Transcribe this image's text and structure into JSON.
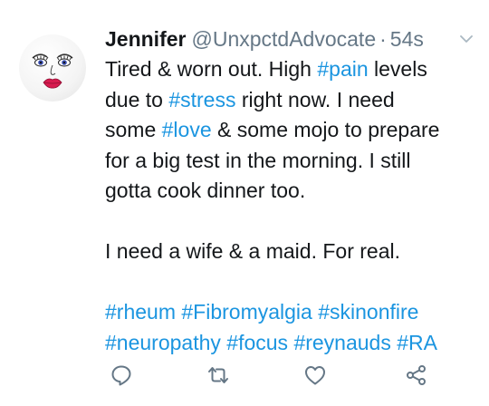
{
  "tweet": {
    "display_name": "Jennifer",
    "handle": "@UnxpctdAdvocate",
    "separator": "·",
    "timestamp": "54s",
    "lines": [
      [
        {
          "t": "Tired & worn out. High ",
          "tag": false
        },
        {
          "t": "#pain",
          "tag": true
        },
        {
          "t": " levels",
          "tag": false
        }
      ],
      [
        {
          "t": "due to ",
          "tag": false
        },
        {
          "t": "#stress",
          "tag": true
        },
        {
          "t": " right now. I need",
          "tag": false
        }
      ],
      [
        {
          "t": "some ",
          "tag": false
        },
        {
          "t": "#love",
          "tag": true
        },
        {
          "t": " & some mojo to prepare",
          "tag": false
        }
      ],
      [
        {
          "t": "for a big test in the morning. I still",
          "tag": false
        }
      ],
      [
        {
          "t": "gotta cook dinner too.",
          "tag": false
        }
      ],
      [],
      [
        {
          "t": "I need a wife & a maid. For real.",
          "tag": false
        }
      ],
      [],
      [
        {
          "t": "#rheum",
          "tag": true
        },
        {
          "t": " ",
          "tag": false
        },
        {
          "t": "#Fibromyalgia",
          "tag": true
        },
        {
          "t": " ",
          "tag": false
        },
        {
          "t": "#skinonfire",
          "tag": true
        }
      ],
      [
        {
          "t": "#neuropathy",
          "tag": true
        },
        {
          "t": " ",
          "tag": false
        },
        {
          "t": "#focus",
          "tag": true
        },
        {
          "t": " ",
          "tag": false
        },
        {
          "t": "#reynauds",
          "tag": true
        },
        {
          "t": " ",
          "tag": false
        },
        {
          "t": "#RA",
          "tag": true
        }
      ]
    ]
  },
  "actions": [
    {
      "name": "reply-button",
      "icon": "reply-icon"
    },
    {
      "name": "retweet-button",
      "icon": "retweet-icon"
    },
    {
      "name": "like-button",
      "icon": "heart-icon"
    },
    {
      "name": "share-button",
      "icon": "share-icon"
    }
  ],
  "colors": {
    "text": "#14171a",
    "muted": "#657786",
    "hashtag": "#1b95e0",
    "background": "#ffffff"
  }
}
